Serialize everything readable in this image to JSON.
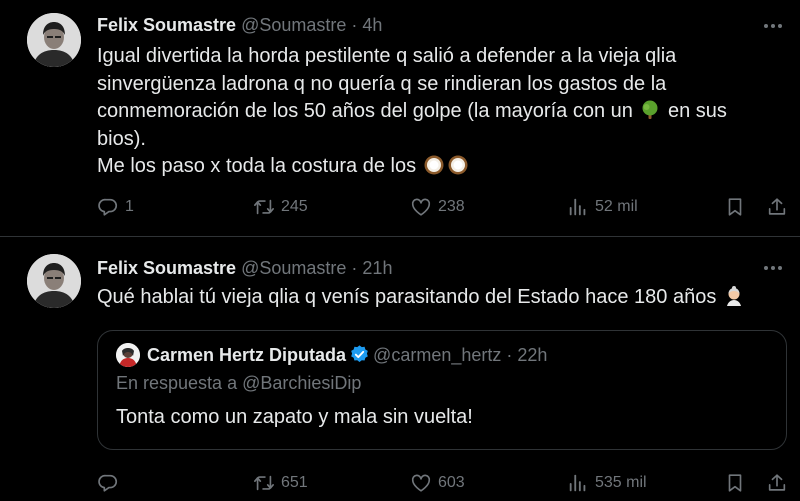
{
  "tweets": [
    {
      "author": {
        "name": "Felix Soumastre",
        "handle": "@Soumastre",
        "separator": "·",
        "time": "4h"
      },
      "body": {
        "line1": "Igual divertida la horda pestilente q salió a defender a la vieja qlia sinvergüenza ladrona q no quería q se rindieran los gastos de la conmemoración de los 50 años del golpe (la mayoría con un",
        "line1_end": "en sus bios).",
        "line2": "Me los paso x toda la costura de los",
        "emoji_icons": [
          "tree-emoji",
          "coconut-emoji"
        ]
      },
      "actions": {
        "replies": "1",
        "retweets": "245",
        "likes": "238",
        "views": "52 mil"
      }
    },
    {
      "author": {
        "name": "Felix Soumastre",
        "handle": "@Soumastre",
        "separator": "·",
        "time": "21h"
      },
      "body": {
        "line1": "Qué hablai tú vieja qlia q venís parasitando del Estado hace 180 años",
        "emoji_icons": [
          "old-woman-emoji"
        ]
      },
      "quote": {
        "name": "Carmen Hertz Diputada",
        "handle": "@carmen_hertz",
        "separator": "·",
        "time": "22h",
        "reply_to": "En respuesta a @BarchiesiDip",
        "text": "Tonta como un zapato y mala sin vuelta!"
      },
      "actions": {
        "replies": "",
        "retweets": "651",
        "likes": "603",
        "views": "535 mil"
      }
    }
  ],
  "colors": {
    "background": "#000000",
    "text": "#e7e9ea",
    "muted": "#71767b",
    "border": "#2f3336",
    "verified": "#1d9bf0"
  }
}
